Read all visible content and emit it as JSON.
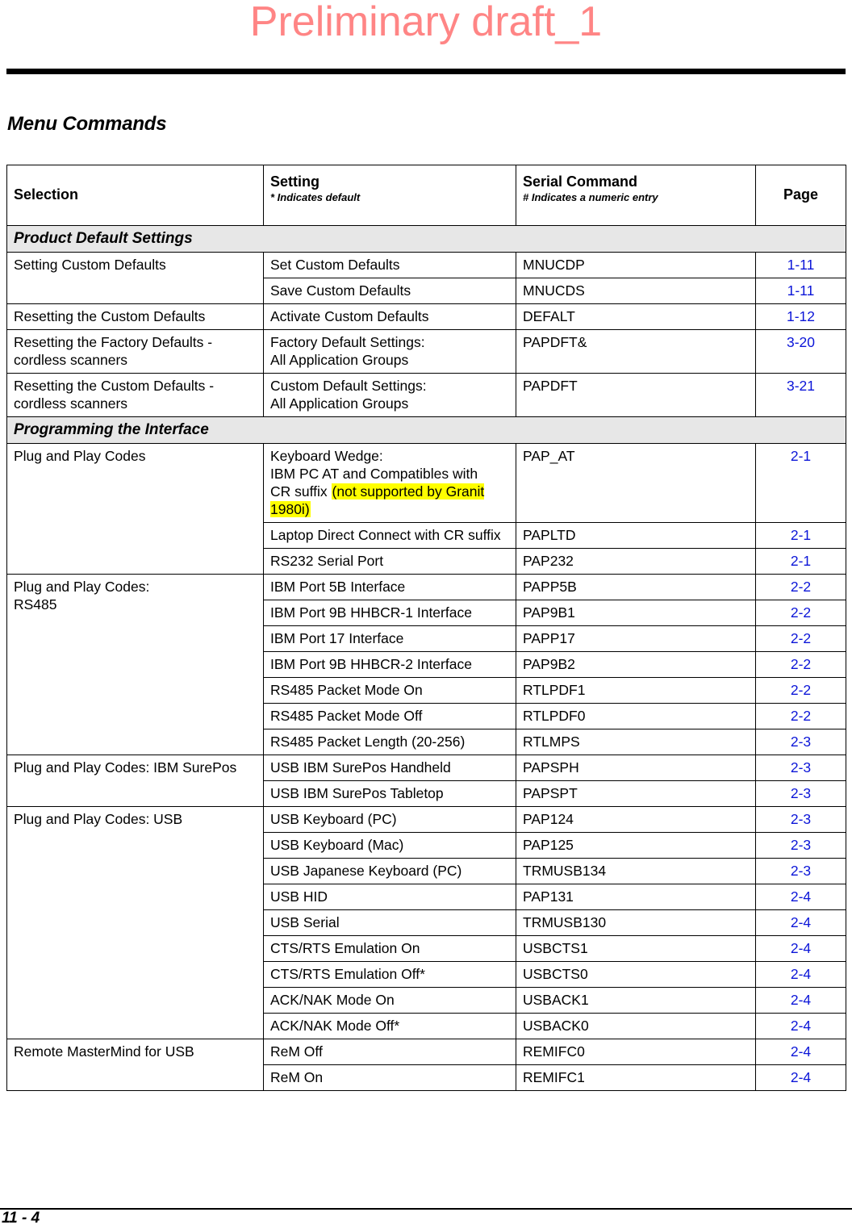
{
  "watermark": {
    "text": "Preliminary draft_1",
    "color": "#ff8585"
  },
  "page_heading": "Menu Commands",
  "footer": {
    "page_label": "11 - 4"
  },
  "colors": {
    "page_link": "#0b15d8",
    "section_band": "#e7e7e7",
    "highlight": "#ffff00"
  },
  "table": {
    "header": {
      "selection": "Selection",
      "setting_main": "Setting",
      "setting_sub": "* Indicates default",
      "serial_main": "Serial Command",
      "serial_sub": "# Indicates a numeric entry",
      "page": "Page"
    },
    "sections": [
      {
        "title": "Product Default Settings",
        "groups": [
          {
            "selection": "Setting Custom Defaults",
            "rows": [
              {
                "setting": "Set Custom Defaults",
                "serial": "MNUCDP",
                "page": "1-11"
              },
              {
                "setting": "Save Custom Defaults",
                "serial": "MNUCDS",
                "page": "1-11"
              }
            ]
          },
          {
            "selection": "Resetting the Custom Defaults",
            "rows": [
              {
                "setting": "Activate Custom Defaults",
                "serial": "DEFALT",
                "page": "1-12"
              }
            ]
          },
          {
            "selection": "Resetting the Factory Defaults - cordless scanners",
            "rows": [
              {
                "setting": "Factory Default Settings:\nAll Application Groups",
                "serial": "PAPDFT&",
                "page": "3-20"
              }
            ]
          },
          {
            "selection": "Resetting the Custom Defaults - cordless scanners",
            "rows": [
              {
                "setting": "Custom Default Settings:\nAll Application Groups",
                "serial": "PAPDFT",
                "page": "3-21"
              }
            ]
          }
        ]
      },
      {
        "title": "Programming the Interface",
        "groups": [
          {
            "selection": "Plug and Play Codes",
            "rows": [
              {
                "setting_pre": "Keyboard Wedge:\nIBM PC AT and Compatibles with\nCR suffix ",
                "setting_highlight": "(not supported by Granit 1980i)",
                "serial": "PAP_AT",
                "page": "2-1"
              },
              {
                "setting": "Laptop Direct Connect with CR suffix",
                "serial": "PAPLTD",
                "page": "2-1"
              },
              {
                "setting": "RS232 Serial Port",
                "serial": "PAP232",
                "page": "2-1"
              }
            ]
          },
          {
            "selection": "Plug and Play Codes:\nRS485",
            "rows": [
              {
                "setting": "IBM Port 5B Interface",
                "serial": "PAPP5B",
                "page": "2-2"
              },
              {
                "setting": "IBM Port 9B HHBCR-1 Interface",
                "serial": "PAP9B1",
                "page": "2-2"
              },
              {
                "setting": "IBM Port 17 Interface",
                "serial": "PAPP17",
                "page": "2-2"
              },
              {
                "setting": "IBM Port 9B HHBCR-2 Interface",
                "serial": "PAP9B2",
                "page": "2-2"
              },
              {
                "setting": "RS485 Packet Mode On",
                "serial": "RTLPDF1",
                "page": "2-2"
              },
              {
                "setting": "RS485 Packet Mode Off",
                "serial": "RTLPDF0",
                "page": "2-2"
              },
              {
                "setting": "RS485 Packet Length (20-256)",
                "serial": "RTLMPS",
                "page": "2-3"
              }
            ]
          },
          {
            "selection": "Plug and Play Codes: IBM SurePos",
            "rows": [
              {
                "setting": "USB IBM SurePos Handheld",
                "serial": "PAPSPH",
                "page": "2-3"
              },
              {
                "setting": "USB IBM SurePos Tabletop",
                "serial": "PAPSPT",
                "page": "2-3"
              }
            ]
          },
          {
            "selection": "Plug and Play Codes: USB",
            "rows": [
              {
                "setting": "USB Keyboard (PC)",
                "serial": "PAP124",
                "page": "2-3"
              },
              {
                "setting": "USB Keyboard (Mac)",
                "serial": "PAP125",
                "page": "2-3"
              },
              {
                "setting": "USB Japanese Keyboard (PC)",
                "serial": "TRMUSB134",
                "page": "2-3"
              },
              {
                "setting": "USB HID",
                "serial": "PAP131",
                "page": "2-4"
              },
              {
                "setting": "USB Serial",
                "serial": "TRMUSB130",
                "page": "2-4"
              },
              {
                "setting": "CTS/RTS Emulation On",
                "serial": "USBCTS1",
                "page": "2-4"
              },
              {
                "setting": "CTS/RTS Emulation Off*",
                "serial": "USBCTS0",
                "page": "2-4"
              },
              {
                "setting": "ACK/NAK Mode On",
                "serial": "USBACK1",
                "page": "2-4"
              },
              {
                "setting": "ACK/NAK Mode Off*",
                "serial": "USBACK0",
                "page": "2-4"
              }
            ]
          },
          {
            "selection": "Remote MasterMind for USB",
            "rows": [
              {
                "setting": "ReM Off",
                "serial": "REMIFC0",
                "page": "2-4"
              },
              {
                "setting": "ReM On",
                "serial": "REMIFC1",
                "page": "2-4"
              }
            ]
          }
        ]
      }
    ]
  }
}
